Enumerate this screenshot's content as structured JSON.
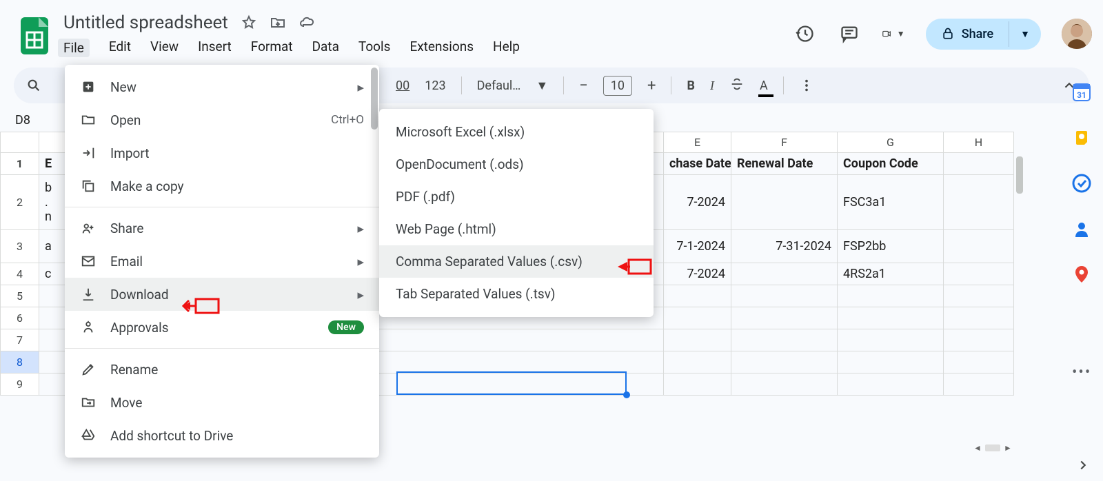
{
  "header": {
    "doc_title": "Untitled spreadsheet",
    "menubar": [
      "File",
      "Edit",
      "View",
      "Insert",
      "Format",
      "Data",
      "Tools",
      "Extensions",
      "Help"
    ],
    "share_label": "Share"
  },
  "toolbar": {
    "number_format": "123",
    "suffix_00": "00",
    "font": "Defaul…",
    "font_size": "10"
  },
  "namebox": "D8",
  "file_menu": {
    "items": [
      {
        "label": "New",
        "type": "sub"
      },
      {
        "label": "Open",
        "type": "shortcut",
        "shortcut": "Ctrl+O"
      },
      {
        "label": "Import",
        "type": "plain"
      },
      {
        "label": "Make a copy",
        "type": "plain"
      },
      {
        "type": "divider"
      },
      {
        "label": "Share",
        "type": "sub"
      },
      {
        "label": "Email",
        "type": "sub"
      },
      {
        "label": "Download",
        "type": "sub",
        "hover": true
      },
      {
        "label": "Approvals",
        "type": "badge",
        "badge": "New"
      },
      {
        "type": "divider"
      },
      {
        "label": "Rename",
        "type": "plain"
      },
      {
        "label": "Move",
        "type": "plain"
      },
      {
        "label": "Add shortcut to Drive",
        "type": "plain"
      }
    ]
  },
  "download_submenu": {
    "items": [
      {
        "label": "Microsoft Excel (.xlsx)"
      },
      {
        "label": "OpenDocument (.ods)"
      },
      {
        "label": "PDF (.pdf)"
      },
      {
        "label": "Web Page (.html)"
      },
      {
        "label": "Comma Separated Values (.csv)",
        "hover": true
      },
      {
        "label": "Tab Separated Values (.tsv)"
      }
    ]
  },
  "grid": {
    "col_headers": [
      "",
      "E",
      "F",
      "G",
      "H"
    ],
    "row_labels": [
      "1",
      "2",
      "3",
      "4",
      "5",
      "6",
      "7",
      "8",
      "9"
    ],
    "rows": [
      {
        "a": "E",
        "e": "chase Date",
        "f": "Renewal Date",
        "g": "Coupon Code",
        "h": ""
      },
      {
        "a": "b",
        "e": "7-2024",
        "f": "",
        "g": "FSC3a1",
        "h": "",
        "sub": "n"
      },
      {
        "a": "a",
        "e": "7-1-2024",
        "f": "7-31-2024",
        "g": "FSP2bb",
        "h": ""
      },
      {
        "a": "c",
        "e": "7-2024",
        "f": "",
        "g": "4RS2a1",
        "h": ""
      },
      {
        "a": "",
        "e": "",
        "f": "",
        "g": "",
        "h": ""
      },
      {
        "a": "",
        "e": "",
        "f": "",
        "g": "",
        "h": ""
      },
      {
        "a": "",
        "e": "",
        "f": "",
        "g": "",
        "h": ""
      },
      {
        "a": "",
        "e": "",
        "f": "",
        "g": "",
        "h": ""
      },
      {
        "a": "",
        "e": "",
        "f": "",
        "g": "",
        "h": ""
      }
    ]
  },
  "sidepanel_day": "31"
}
